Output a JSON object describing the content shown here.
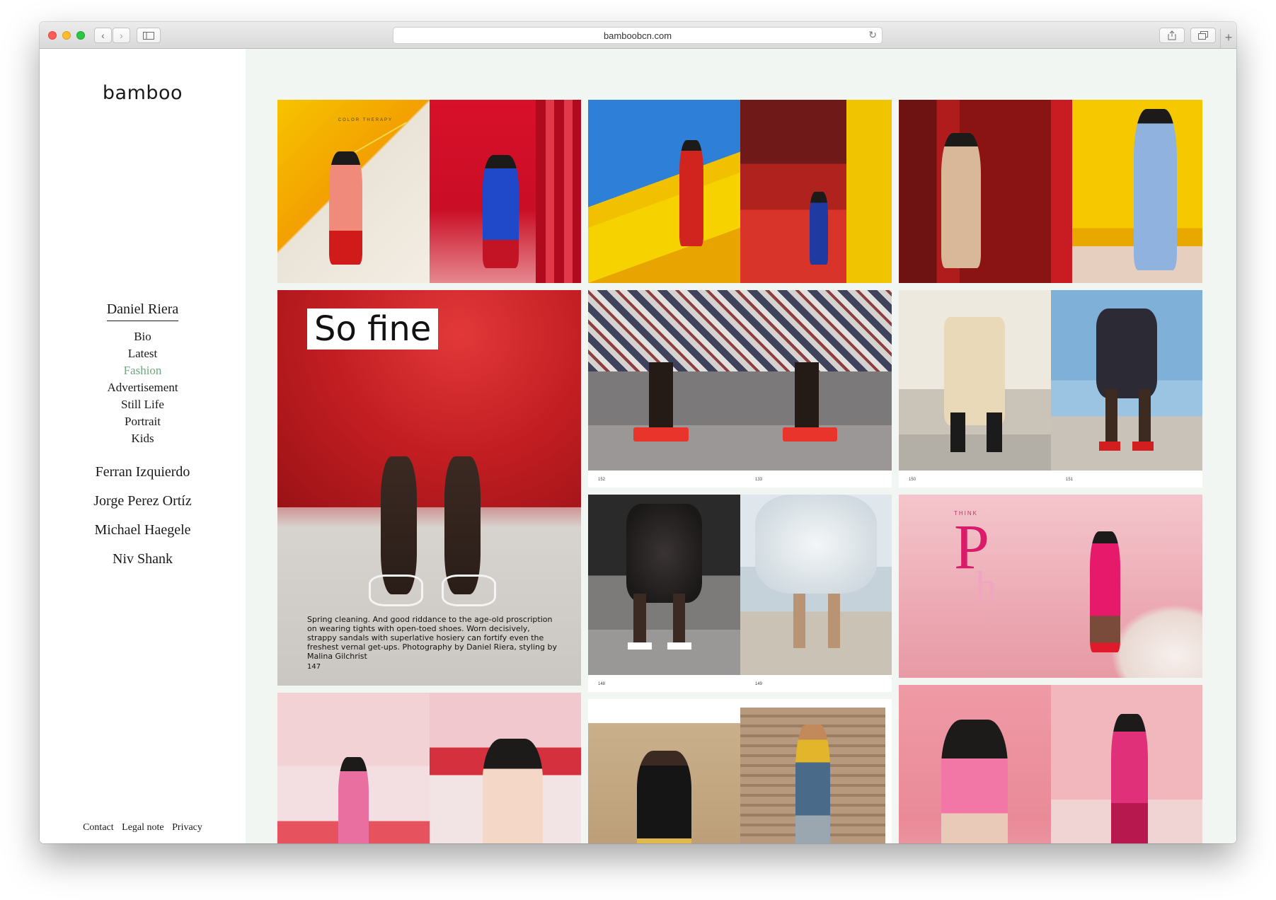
{
  "browser": {
    "url": "bamboobcn.com"
  },
  "sidebar": {
    "logo": "bamboo",
    "active_photographer": "Daniel Riera",
    "sub_items": [
      "Bio",
      "Latest",
      "Fashion",
      "Advertisement",
      "Still Life",
      "Portrait",
      "Kids"
    ],
    "active_sub_item": "Fashion",
    "other_photographers": [
      "Ferran Izquierdo",
      "Jorge Perez Ortíz",
      "Michael Haegele",
      "Niv Shank"
    ],
    "footer": [
      "Contact",
      "Legal note",
      "Privacy"
    ]
  },
  "gallery": {
    "sofine_title": "So fine",
    "sofine_caption": "Spring cleaning. And good riddance to the age-old proscription on wearing tights with open-toed shoes. Worn decisively, strappy sandals with superlative hosiery can fortify even the freshest vernal get-ups. Photography by Daniel Riera, styling by Malina Gilchrist",
    "sofine_page": "147",
    "color_therapy": "COLOR THERAPY",
    "think_pink": "THINK",
    "page_numbers": [
      "152",
      "133",
      "150",
      "151",
      "148",
      "149"
    ]
  },
  "colors": {
    "active_nav": "#6aaa7e",
    "gallery_bg": "#f2f6f3"
  }
}
